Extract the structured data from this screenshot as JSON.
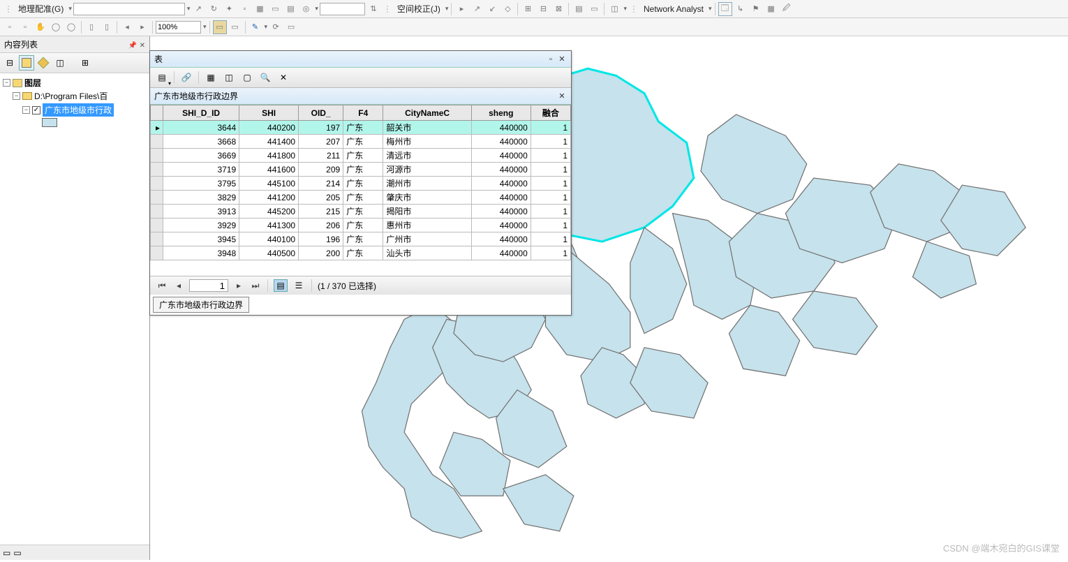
{
  "toolbar1": {
    "georef_label": "地理配准(G)",
    "spatial_adj_label": "空间校正(J)",
    "network_analyst_label": "Network Analyst"
  },
  "toolbar2": {
    "zoom_value": "100%"
  },
  "toc": {
    "title": "内容列表",
    "layers_label": "图层",
    "path_label": "D:\\Program Files\\百",
    "layer_name": "广东市地级市行政",
    "checkbox_checked": "✓"
  },
  "table_window": {
    "title": "表",
    "subtitle": "广东市地级市行政边界",
    "tab_label": "广东市地级市行政边界",
    "columns": [
      "SHI_D_ID",
      "SHI",
      "OID_",
      "F4",
      "CityNameC",
      "sheng",
      "融合"
    ],
    "rows": [
      {
        "SHI_D_ID": 3644,
        "SHI": 440200,
        "OID_": 197,
        "F4": "广东",
        "CityNameC": "韶关市",
        "sheng": 440000,
        "merge": 1,
        "selected": true
      },
      {
        "SHI_D_ID": 3668,
        "SHI": 441400,
        "OID_": 207,
        "F4": "广东",
        "CityNameC": "梅州市",
        "sheng": 440000,
        "merge": 1,
        "selected": false
      },
      {
        "SHI_D_ID": 3669,
        "SHI": 441800,
        "OID_": 211,
        "F4": "广东",
        "CityNameC": "清远市",
        "sheng": 440000,
        "merge": 1,
        "selected": false
      },
      {
        "SHI_D_ID": 3719,
        "SHI": 441600,
        "OID_": 209,
        "F4": "广东",
        "CityNameC": "河源市",
        "sheng": 440000,
        "merge": 1,
        "selected": false
      },
      {
        "SHI_D_ID": 3795,
        "SHI": 445100,
        "OID_": 214,
        "F4": "广东",
        "CityNameC": "潮州市",
        "sheng": 440000,
        "merge": 1,
        "selected": false
      },
      {
        "SHI_D_ID": 3829,
        "SHI": 441200,
        "OID_": 205,
        "F4": "广东",
        "CityNameC": "肇庆市",
        "sheng": 440000,
        "merge": 1,
        "selected": false
      },
      {
        "SHI_D_ID": 3913,
        "SHI": 445200,
        "OID_": 215,
        "F4": "广东",
        "CityNameC": "揭阳市",
        "sheng": 440000,
        "merge": 1,
        "selected": false
      },
      {
        "SHI_D_ID": 3929,
        "SHI": 441300,
        "OID_": 206,
        "F4": "广东",
        "CityNameC": "惠州市",
        "sheng": 440000,
        "merge": 1,
        "selected": false
      },
      {
        "SHI_D_ID": 3945,
        "SHI": 440100,
        "OID_": 196,
        "F4": "广东",
        "CityNameC": "广州市",
        "sheng": 440000,
        "merge": 1,
        "selected": false
      },
      {
        "SHI_D_ID": 3948,
        "SHI": 440500,
        "OID_": 200,
        "F4": "广东",
        "CityNameC": "汕头市",
        "sheng": 440000,
        "merge": 1,
        "selected": false
      }
    ],
    "nav": {
      "current_record": "1",
      "status": "(1 / 370 已选择)"
    }
  },
  "watermark": "CSDN @端木宛白的GIS课堂"
}
